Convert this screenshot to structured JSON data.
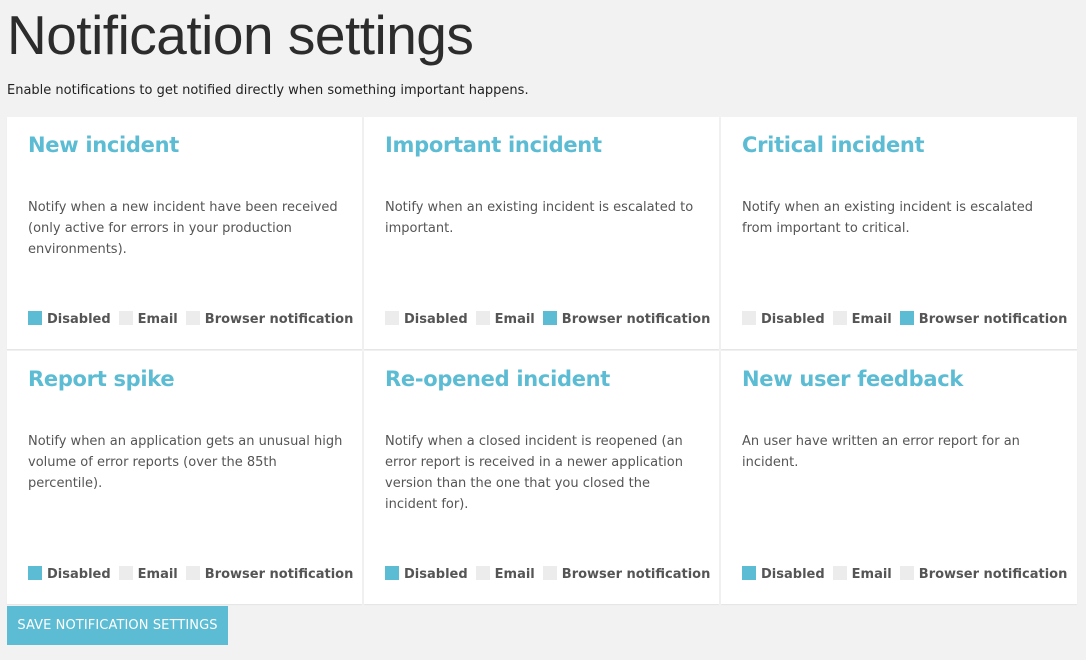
{
  "page": {
    "title": "Notification settings",
    "description": "Enable notifications to get notified directly when something important happens."
  },
  "option_labels": {
    "disabled": "Disabled",
    "email": "Email",
    "browser": "Browser notification"
  },
  "cards": [
    {
      "title": "New incident",
      "description": "Notify when a new incident have been received (only active for errors in your production environments).",
      "selected": "disabled"
    },
    {
      "title": "Important incident",
      "description": "Notify when an existing incident is escalated to important.",
      "selected": "browser"
    },
    {
      "title": "Critical incident",
      "description": "Notify when an existing incident is escalated from important to critical.",
      "selected": "browser"
    },
    {
      "title": "Report spike",
      "description": "Notify when an application gets an unusual high volume of error reports (over the 85th percentile).",
      "selected": "disabled"
    },
    {
      "title": "Re-opened incident",
      "description": "Notify when a closed incident is reopened (an error report is received in a newer application version than the one that you closed the incident for).",
      "selected": "disabled"
    },
    {
      "title": "New user feedback",
      "description": "An user have written an error report for an incident.",
      "selected": "disabled"
    }
  ],
  "save_button": {
    "label": "SAVE NOTIFICATION SETTINGS"
  },
  "colors": {
    "accent": "#5bbcd3",
    "unchecked": "#ececec",
    "background": "#f2f2f2"
  }
}
